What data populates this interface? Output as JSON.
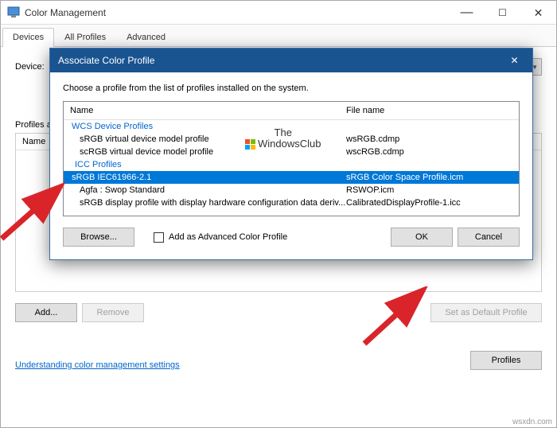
{
  "window": {
    "title": "Color Management"
  },
  "tabs": {
    "devices": "Devices",
    "all_profiles": "All Profiles",
    "advanced": "Advanced"
  },
  "main": {
    "device_label": "Device:",
    "profiles_label": "Profiles associated with this device:",
    "name_col": "Name",
    "add_btn": "Add...",
    "remove_btn": "Remove",
    "set_default_btn": "Set as Default Profile",
    "profiles_btn": "Profiles",
    "link": "Understanding color management settings"
  },
  "dialog": {
    "title": "Associate Color Profile",
    "instruction": "Choose a profile from the list of profiles installed on the system.",
    "col_name": "Name",
    "col_file": "File name",
    "group_wcs": "WCS Device Profiles",
    "group_icc": "ICC Profiles",
    "rows": [
      {
        "name": "sRGB virtual device model profile",
        "file": "wsRGB.cdmp"
      },
      {
        "name": "scRGB virtual device model profile",
        "file": "wscRGB.cdmp"
      }
    ],
    "selected": {
      "name": "sRGB IEC61966-2.1",
      "file": "sRGB Color Space Profile.icm"
    },
    "icc_rows": [
      {
        "name": "Agfa : Swop Standard",
        "file": "RSWOP.icm"
      },
      {
        "name": "sRGB display profile with display hardware configuration data deriv...",
        "file": "CalibratedDisplayProfile-1.icc"
      }
    ],
    "browse_btn": "Browse...",
    "checkbox_label": "Add as Advanced Color Profile",
    "ok_btn": "OK",
    "cancel_btn": "Cancel"
  },
  "watermark": {
    "line1": "The",
    "line2": "WindowsClub"
  },
  "footer": "wsxdn.com"
}
